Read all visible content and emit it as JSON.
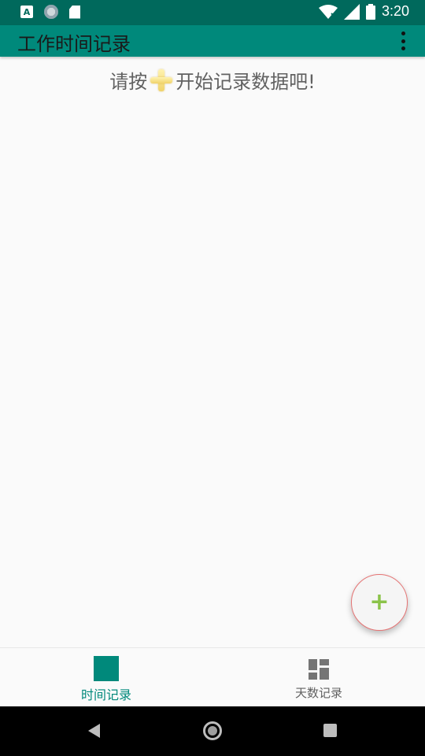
{
  "status_bar": {
    "time": "3:20",
    "left_icons": [
      "a-notification-icon",
      "sync-circle-icon",
      "sd-card-icon"
    ],
    "right_icons": [
      "wifi-icon",
      "signal-icon",
      "battery-icon"
    ]
  },
  "app_bar": {
    "title": "工作时间记录",
    "menu_icon": "overflow-menu-icon"
  },
  "main": {
    "empty_prompt_before": "请按",
    "empty_prompt_after": "开始记录数据吧!",
    "prompt_icon": "plus-icon"
  },
  "fab": {
    "label": "+",
    "icon": "add-icon"
  },
  "bottom_nav": {
    "items": [
      {
        "label": "时间记录",
        "icon": "square-icon",
        "active": true
      },
      {
        "label": "天数记录",
        "icon": "dashboard-icon",
        "active": false
      }
    ]
  },
  "system_nav": {
    "buttons": [
      "back-icon",
      "home-icon",
      "recents-icon"
    ]
  },
  "colors": {
    "primary_dark": "#00695c",
    "primary": "#00897b",
    "fab_plus": "#8bc34a",
    "background": "#fafafa"
  }
}
